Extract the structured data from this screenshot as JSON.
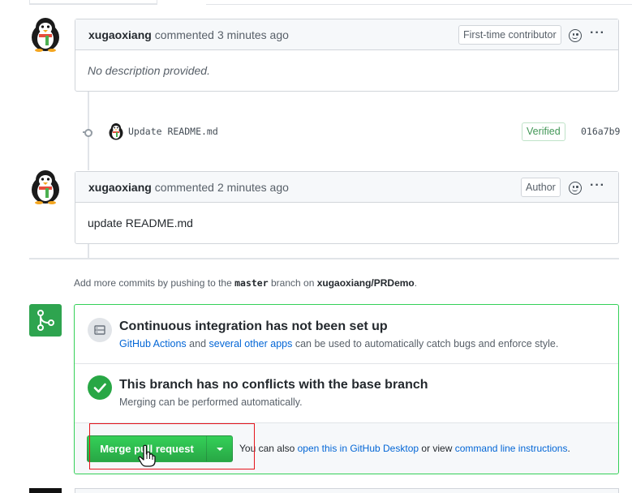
{
  "comments": [
    {
      "author": "xugaoxiang",
      "action": "commented",
      "time": "3 minutes ago",
      "badge": "First-time contributor",
      "body": "No description provided."
    },
    {
      "author": "xugaoxiang",
      "action": "commented",
      "time": "2 minutes ago",
      "badge": "Author",
      "body": "update README.md"
    }
  ],
  "commit": {
    "message": "Update README.md",
    "verified": "Verified",
    "sha": "016a7b9"
  },
  "hint": {
    "prefix": "Add more commits by pushing to the",
    "branch": "master",
    "middle": "branch on",
    "repo": "xugaoxiang/PRDemo",
    "suffix": "."
  },
  "merge": {
    "ci": {
      "title": "Continuous integration has not been set up",
      "link1": "GitHub Actions",
      "and": "and",
      "link2": "several other apps",
      "rest": "can be used to automatically catch bugs and enforce style."
    },
    "conflicts": {
      "title": "This branch has no conflicts with the base branch",
      "subtitle": "Merging can be performed automatically."
    },
    "button_label": "Merge pull request",
    "footer": {
      "prefix": "You can also",
      "link1": "open this in GitHub Desktop",
      "middle": "or view",
      "link2": "command line instructions",
      "suffix": "."
    }
  },
  "icons": {
    "avatar": "penguin-avatar-icon",
    "reaction": "smiley-icon",
    "more": "kebab-icon",
    "commit": "git-commit-icon",
    "merge": "git-merge-icon",
    "ci": "server-icon",
    "check": "check-icon",
    "caret": "triangle-down-icon",
    "cursor": "hand-pointer-icon"
  },
  "colors": {
    "green": "#2ea44f",
    "link": "#0366d6",
    "highlight": "#e5141b"
  }
}
